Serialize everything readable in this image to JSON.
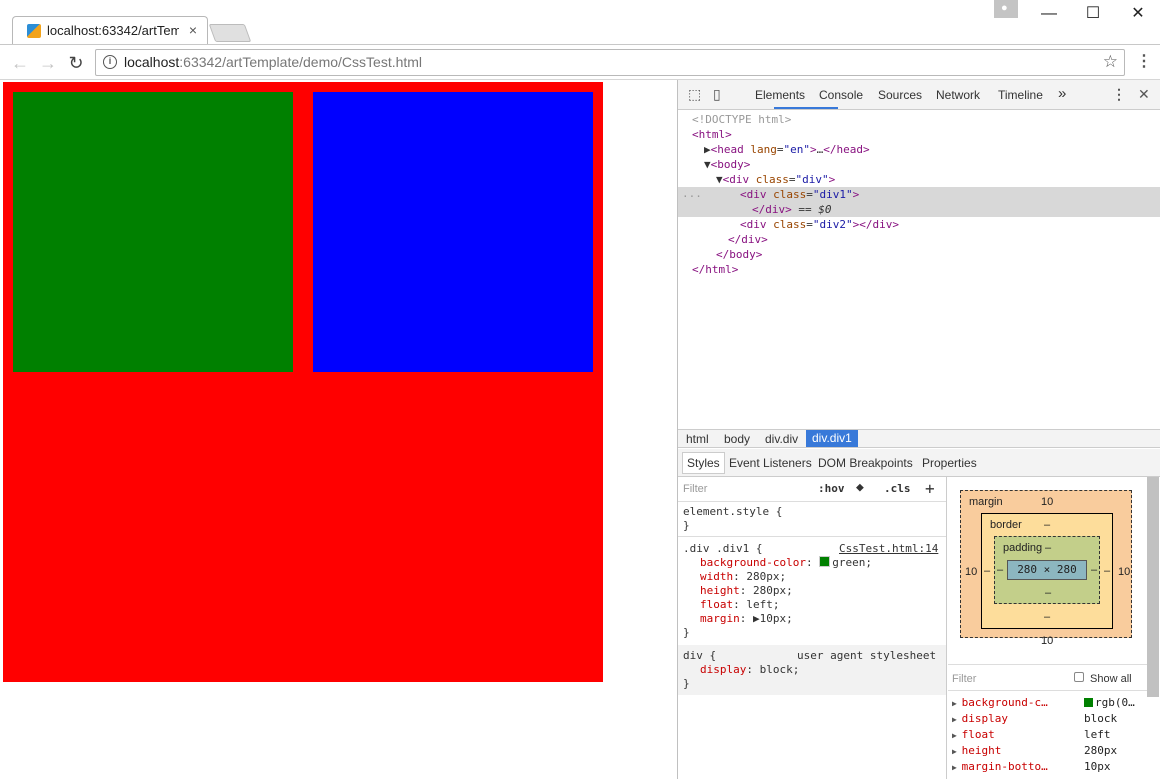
{
  "browser": {
    "tab_title": "localhost:63342/artTem",
    "tab_close": "×",
    "window_controls": {
      "minimize": "—",
      "maximize": "☐",
      "close": "✕"
    },
    "address": {
      "host": "localhost",
      "rest": ":63342/artTemplate/demo/CssTest.html"
    }
  },
  "page": {
    "colors": {
      "outer": "#ff0000",
      "div1": "#008000",
      "div2": "#0000ff"
    }
  },
  "devtools": {
    "tabs": [
      "Elements",
      "Console",
      "Sources",
      "Network",
      "Timeline"
    ],
    "more": "»",
    "tree": [
      {
        "indent": 1,
        "html": "<!DOCTYPE html>"
      },
      {
        "indent": 1,
        "html": "<html>"
      },
      {
        "indent": 2,
        "html": "▶<head lang=\"en\">…</head>"
      },
      {
        "indent": 2,
        "html": "▼<body>"
      },
      {
        "indent": 3,
        "html": "▼<div class=\"div\">"
      },
      {
        "indent": 5,
        "html": "<div class=\"div1\">"
      },
      {
        "indent": 6,
        "html": "</div> == $0"
      },
      {
        "indent": 5,
        "html": "<div class=\"div2\"></div>"
      },
      {
        "indent": 4,
        "html": "</div>"
      },
      {
        "indent": 3,
        "html": "</body>"
      },
      {
        "indent": 1,
        "html": "</html>"
      }
    ],
    "ellipsis": "...",
    "breadcrumb": [
      "html",
      "body",
      "div.div",
      "div.div1"
    ],
    "subtabs": [
      "Styles",
      "Event Listeners",
      "DOM Breakpoints",
      "Properties"
    ],
    "styles": {
      "filter_placeholder": "Filter",
      "hov": ":hov",
      "cls": ".cls",
      "plus": "+",
      "element_style": "element.style {",
      "close_brace": "}",
      "rule_selector": ".div .div1 {",
      "rule_source": "CssTest.html:14",
      "props": [
        {
          "name": "background-color",
          "value": "green;",
          "swatch": "#008000"
        },
        {
          "name": "width",
          "value": "280px;"
        },
        {
          "name": "height",
          "value": "280px;"
        },
        {
          "name": "float",
          "value": "left;"
        },
        {
          "name": "margin",
          "value": "▶10px;"
        }
      ],
      "ua_selector": "div {",
      "ua_source": "user agent stylesheet",
      "ua_prop": {
        "name": "display",
        "value": "block;"
      }
    },
    "box_model": {
      "margin_label": "margin",
      "margin_top": "10",
      "margin_bottom": "10",
      "margin_left": "10",
      "margin_right": "10",
      "border_label": "border",
      "border_dash": "–",
      "padding_label": "padding",
      "padding_dash": "–",
      "content": "280 × 280"
    },
    "computed": {
      "filter_placeholder": "Filter",
      "show_all": "Show all",
      "rows": [
        {
          "name": "background-c…",
          "value": "rgb(0…",
          "swatch": "#008000"
        },
        {
          "name": "display",
          "value": "block"
        },
        {
          "name": "float",
          "value": "left"
        },
        {
          "name": "height",
          "value": "280px"
        },
        {
          "name": "margin-botto…",
          "value": "10px"
        }
      ]
    }
  }
}
